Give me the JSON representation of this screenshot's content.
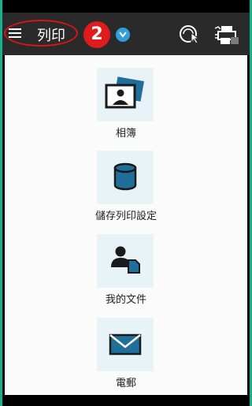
{
  "header": {
    "title": "列印",
    "badge_number": "2",
    "menu_icon": "hamburger-menu-icon",
    "dropdown_icon": "chevron-down-icon",
    "action_icons": [
      "touch-connect-icon",
      "printer-icon"
    ]
  },
  "menu_items": [
    {
      "label": "相簿",
      "icon": "photo-album-icon"
    },
    {
      "label": "儲存列印設定",
      "icon": "saved-settings-icon"
    },
    {
      "label": "我的文件",
      "icon": "my-documents-icon"
    },
    {
      "label": "電郵",
      "icon": "email-icon"
    }
  ],
  "colors": {
    "header_bg": "#2a2a2a",
    "accent_blue": "#1f6f9a",
    "tile_bg": "#e8f3f8",
    "highlight_red": "#e01b1b",
    "border_teal": "#14b38e"
  }
}
